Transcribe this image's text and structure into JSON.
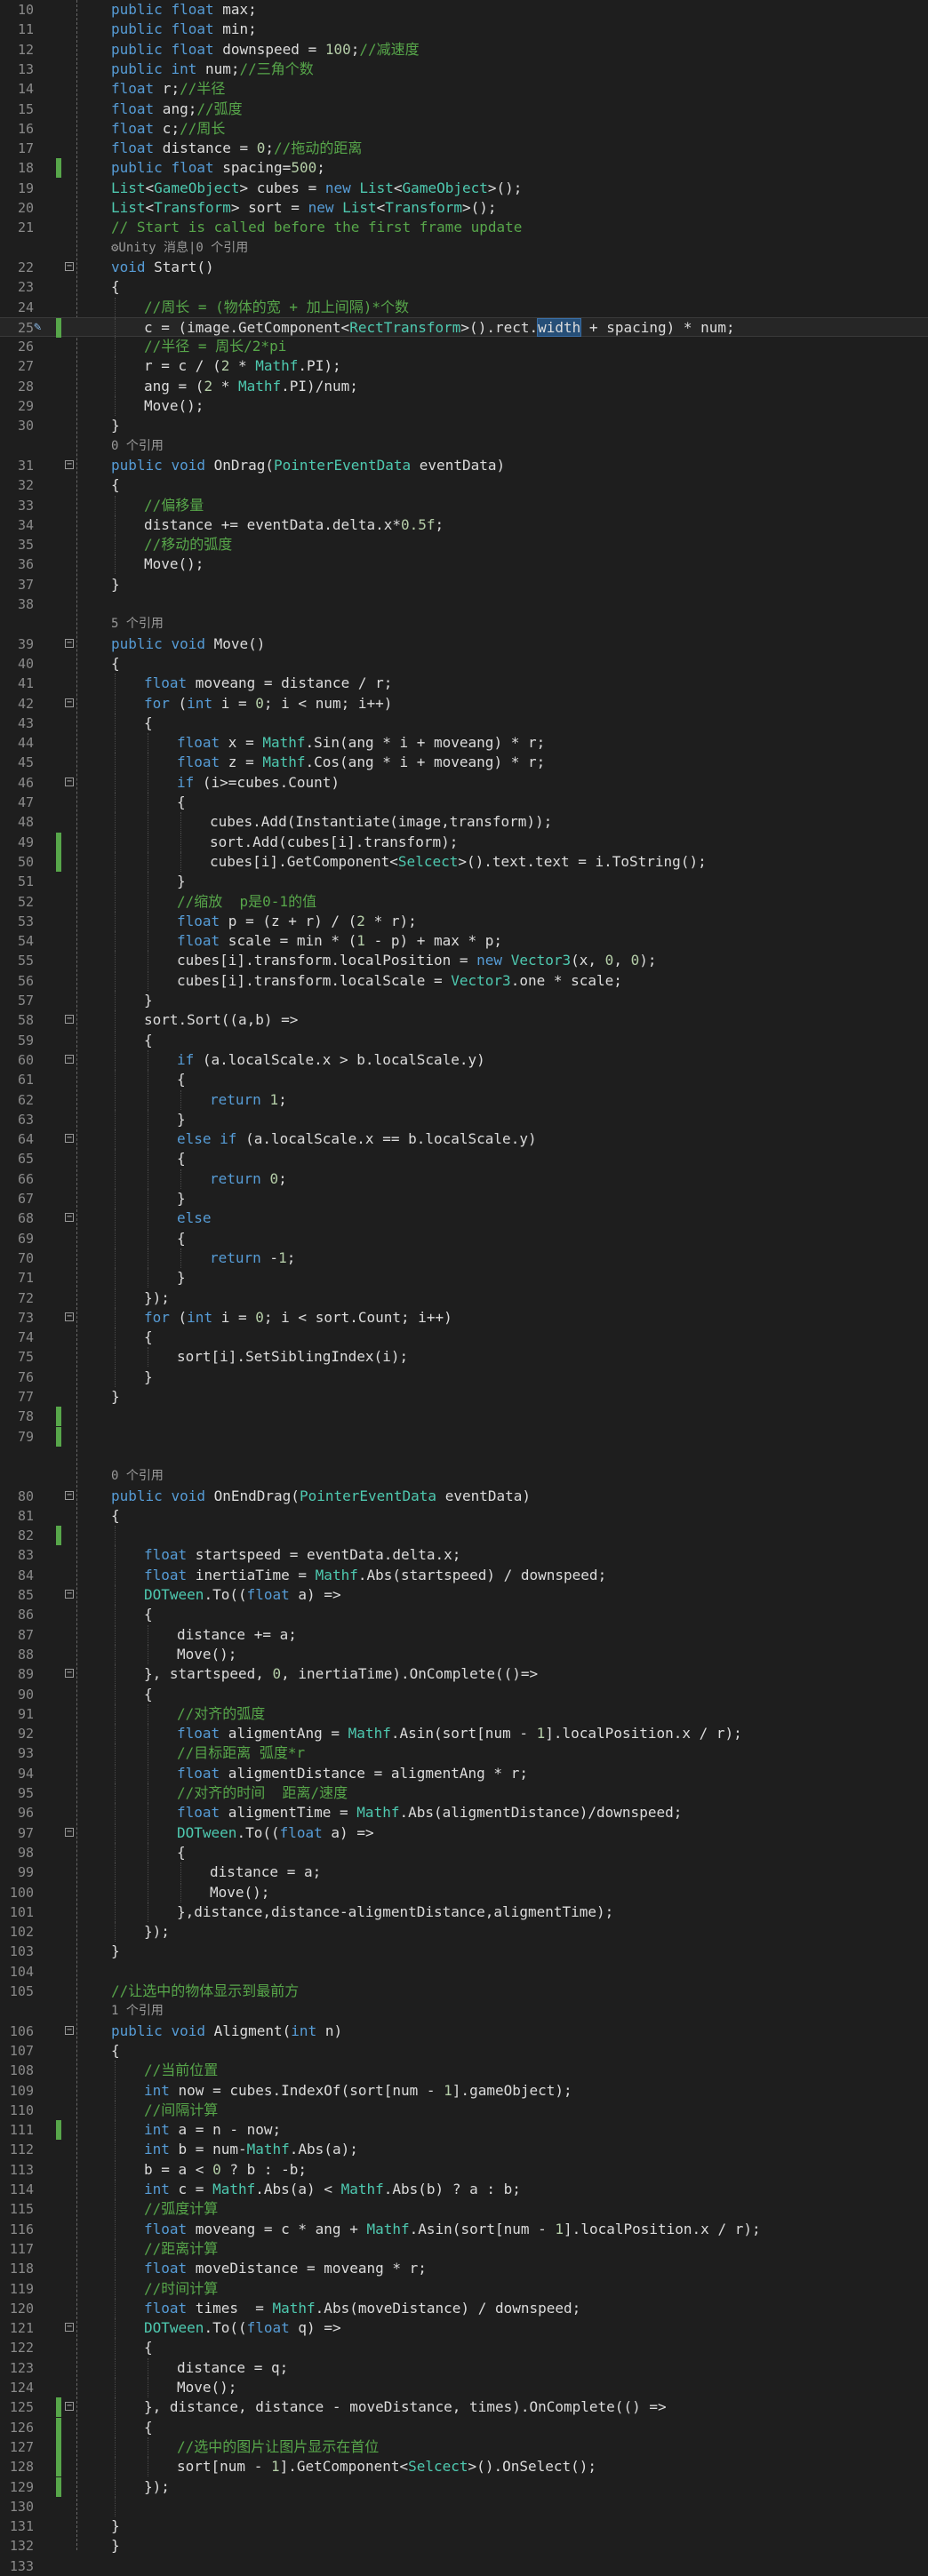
{
  "editor": {
    "lines": [
      {
        "n": "10",
        "ind": 1,
        "h": "<span class=\"kw\">public</span> <span class=\"kw\">float</span> max;",
        "chg": false
      },
      {
        "n": "11",
        "ind": 1,
        "h": "<span class=\"kw\">public</span> <span class=\"kw\">float</span> min;",
        "chg": false
      },
      {
        "n": "12",
        "ind": 1,
        "h": "<span class=\"kw\">public</span> <span class=\"kw\">float</span> downspeed = <span class=\"nm\">100</span>;<span class=\"cm\">//减速度</span>",
        "chg": false
      },
      {
        "n": "13",
        "ind": 1,
        "h": "<span class=\"kw\">public</span> <span class=\"kw\">int</span> num;<span class=\"cm\">//三角个数</span>",
        "chg": false
      },
      {
        "n": "14",
        "ind": 1,
        "h": "<span class=\"kw\">float</span> r;<span class=\"cm\">//半径</span>",
        "chg": false
      },
      {
        "n": "15",
        "ind": 1,
        "h": "<span class=\"kw\">float</span> ang;<span class=\"cm\">//弧度</span>",
        "chg": false
      },
      {
        "n": "16",
        "ind": 1,
        "h": "<span class=\"kw\">float</span> c;<span class=\"cm\">//周长</span>",
        "chg": false
      },
      {
        "n": "17",
        "ind": 1,
        "h": "<span class=\"kw\">float</span> distance = <span class=\"nm\">0</span>;<span class=\"cm\">//拖动的距离</span>",
        "chg": false
      },
      {
        "n": "18",
        "ind": 1,
        "h": "<span class=\"kw\">public</span> <span class=\"kw\">float</span> spacing=<span class=\"nm\">500</span>;",
        "chg": true
      },
      {
        "n": "19",
        "ind": 1,
        "h": "<span class=\"ty\">List</span>&lt;<span class=\"ty\">GameObject</span>&gt; cubes = <span class=\"kw\">new</span> <span class=\"ty\">List</span>&lt;<span class=\"ty\">GameObject</span>&gt;();",
        "chg": false
      },
      {
        "n": "20",
        "ind": 1,
        "h": "<span class=\"ty\">List</span>&lt;<span class=\"ty\">Transform</span>&gt; sort = <span class=\"kw\">new</span> <span class=\"ty\">List</span>&lt;<span class=\"ty\">Transform</span>&gt;();",
        "chg": false
      },
      {
        "n": "21",
        "ind": 1,
        "h": "<span class=\"cm\">// Start is called before the first frame update</span>",
        "chg": false
      },
      {
        "lens": "⚙Unity 消息|0 个引用",
        "ind": 1
      },
      {
        "n": "22",
        "ind": 1,
        "fold": true,
        "h": "<span class=\"kw\">void</span> Start()",
        "chg": false
      },
      {
        "n": "23",
        "ind": 1,
        "h": "{",
        "chg": false
      },
      {
        "n": "24",
        "ind": 2,
        "h": "<span class=\"cm\">//周长 = (物体的宽 + 加上间隔)*个数</span>",
        "chg": false
      },
      {
        "n": "25",
        "ind": 2,
        "cur": true,
        "pen": true,
        "h": "c = (image.GetComponent&lt;<span class=\"ty\">RectTransform</span>&gt;().rect.<span class=\"hl\">width</span> + spacing) * num;",
        "chg": true
      },
      {
        "n": "26",
        "ind": 2,
        "h": "<span class=\"cm\">//半径 = 周长/2*pi</span>",
        "chg": false
      },
      {
        "n": "27",
        "ind": 2,
        "h": "r = c / (<span class=\"nm\">2</span> * <span class=\"ty\">Mathf</span>.PI);",
        "chg": false
      },
      {
        "n": "28",
        "ind": 2,
        "h": "ang = (<span class=\"nm\">2</span> * <span class=\"ty\">Mathf</span>.PI)/num;",
        "chg": false
      },
      {
        "n": "29",
        "ind": 2,
        "h": "Move();",
        "chg": false
      },
      {
        "n": "30",
        "ind": 1,
        "h": "}",
        "chg": false
      },
      {
        "lens": "0 个引用",
        "ind": 1
      },
      {
        "n": "31",
        "ind": 1,
        "fold": true,
        "h": "<span class=\"kw\">public</span> <span class=\"kw\">void</span> OnDrag(<span class=\"ty\">PointerEventData</span> eventData)",
        "chg": false
      },
      {
        "n": "32",
        "ind": 1,
        "h": "{",
        "chg": false
      },
      {
        "n": "33",
        "ind": 2,
        "h": "<span class=\"cm\">//偏移量</span>",
        "chg": false
      },
      {
        "n": "34",
        "ind": 2,
        "h": "distance += eventData.delta.x*<span class=\"nm\">0.5f</span>;",
        "chg": false
      },
      {
        "n": "35",
        "ind": 2,
        "h": "<span class=\"cm\">//移动的弧度</span>",
        "chg": false
      },
      {
        "n": "36",
        "ind": 2,
        "h": "Move();",
        "chg": false
      },
      {
        "n": "37",
        "ind": 1,
        "h": "}",
        "chg": false
      },
      {
        "n": "38",
        "ind": 1,
        "h": "",
        "chg": false
      },
      {
        "lens": "5 个引用",
        "ind": 1
      },
      {
        "n": "39",
        "ind": 1,
        "fold": true,
        "h": "<span class=\"kw\">public</span> <span class=\"kw\">void</span> Move()",
        "chg": false
      },
      {
        "n": "40",
        "ind": 1,
        "h": "{",
        "chg": false
      },
      {
        "n": "41",
        "ind": 2,
        "h": "<span class=\"kw\">float</span> moveang = distance / r;",
        "chg": false
      },
      {
        "n": "42",
        "ind": 2,
        "fold": true,
        "h": "<span class=\"kw\">for</span> (<span class=\"kw\">int</span> i = <span class=\"nm\">0</span>; i &lt; num; i++)",
        "chg": false
      },
      {
        "n": "43",
        "ind": 2,
        "h": "{",
        "chg": false
      },
      {
        "n": "44",
        "ind": 3,
        "h": "<span class=\"kw\">float</span> x = <span class=\"ty\">Mathf</span>.Sin(ang * i + moveang) * r;",
        "chg": false
      },
      {
        "n": "45",
        "ind": 3,
        "h": "<span class=\"kw\">float</span> z = <span class=\"ty\">Mathf</span>.Cos(ang * i + moveang) * r;",
        "chg": false
      },
      {
        "n": "46",
        "ind": 3,
        "fold": true,
        "h": "<span class=\"kw\">if</span> (i&gt;=cubes.Count)",
        "chg": false
      },
      {
        "n": "47",
        "ind": 3,
        "h": "{",
        "chg": false
      },
      {
        "n": "48",
        "ind": 4,
        "h": "cubes.Add(Instantiate(image,transform));",
        "chg": false
      },
      {
        "n": "49",
        "ind": 4,
        "h": "sort.Add(cubes[i].transform);",
        "chg": true
      },
      {
        "n": "50",
        "ind": 4,
        "h": "cubes[i].GetComponent&lt;<span class=\"ty\">Selcect</span>&gt;().text.text = i.ToString();",
        "chg": true
      },
      {
        "n": "51",
        "ind": 3,
        "h": "}",
        "chg": false
      },
      {
        "n": "52",
        "ind": 3,
        "h": "<span class=\"cm\">//缩放  p是0-1的值</span>",
        "chg": false
      },
      {
        "n": "53",
        "ind": 3,
        "h": "<span class=\"kw\">float</span> p = (z + r) / (<span class=\"nm\">2</span> * r);",
        "chg": false
      },
      {
        "n": "54",
        "ind": 3,
        "h": "<span class=\"kw\">float</span> scale = min * (<span class=\"nm\">1</span> - p) + max * p;",
        "chg": false
      },
      {
        "n": "55",
        "ind": 3,
        "h": "cubes[i].transform.localPosition = <span class=\"kw\">new</span> <span class=\"ty\">Vector3</span>(x, <span class=\"nm\">0</span>, <span class=\"nm\">0</span>);",
        "chg": false
      },
      {
        "n": "56",
        "ind": 3,
        "h": "cubes[i].transform.localScale = <span class=\"ty\">Vector3</span>.one * scale;",
        "chg": false
      },
      {
        "n": "57",
        "ind": 2,
        "h": "}",
        "chg": false
      },
      {
        "n": "58",
        "ind": 2,
        "fold": true,
        "h": "sort.Sort((a,b) =&gt;",
        "chg": false
      },
      {
        "n": "59",
        "ind": 2,
        "h": "{",
        "chg": false
      },
      {
        "n": "60",
        "ind": 3,
        "fold": true,
        "h": "<span class=\"kw\">if</span> (a.localScale.x &gt; b.localScale.y)",
        "chg": false
      },
      {
        "n": "61",
        "ind": 3,
        "h": "{",
        "chg": false
      },
      {
        "n": "62",
        "ind": 4,
        "h": "<span class=\"kw\">return</span> <span class=\"nm\">1</span>;",
        "chg": false
      },
      {
        "n": "63",
        "ind": 3,
        "h": "}",
        "chg": false
      },
      {
        "n": "64",
        "ind": 3,
        "fold": true,
        "h": "<span class=\"kw\">else</span> <span class=\"kw\">if</span> (a.localScale.x == b.localScale.y)",
        "chg": false
      },
      {
        "n": "65",
        "ind": 3,
        "h": "{",
        "chg": false
      },
      {
        "n": "66",
        "ind": 4,
        "h": "<span class=\"kw\">return</span> <span class=\"nm\">0</span>;",
        "chg": false
      },
      {
        "n": "67",
        "ind": 3,
        "h": "}",
        "chg": false
      },
      {
        "n": "68",
        "ind": 3,
        "fold": true,
        "h": "<span class=\"kw\">else</span>",
        "chg": false
      },
      {
        "n": "69",
        "ind": 3,
        "h": "{",
        "chg": false
      },
      {
        "n": "70",
        "ind": 4,
        "h": "<span class=\"kw\">return</span> -<span class=\"nm\">1</span>;",
        "chg": false
      },
      {
        "n": "71",
        "ind": 3,
        "h": "}",
        "chg": false
      },
      {
        "n": "72",
        "ind": 2,
        "h": "});",
        "chg": false
      },
      {
        "n": "73",
        "ind": 2,
        "fold": true,
        "h": "<span class=\"kw\">for</span> (<span class=\"kw\">int</span> i = <span class=\"nm\">0</span>; i &lt; sort.Count; i++)",
        "chg": false
      },
      {
        "n": "74",
        "ind": 2,
        "h": "{",
        "chg": false
      },
      {
        "n": "75",
        "ind": 3,
        "h": "sort[i].SetSiblingIndex(i);",
        "chg": false
      },
      {
        "n": "76",
        "ind": 2,
        "h": "}",
        "chg": false
      },
      {
        "n": "77",
        "ind": 1,
        "h": "}",
        "chg": false
      },
      {
        "n": "78",
        "ind": 1,
        "h": "",
        "chg": true
      },
      {
        "n": "79",
        "ind": 1,
        "h": "",
        "chg": true
      },
      {
        "blank": true
      },
      {
        "lens": "0 个引用",
        "ind": 1
      },
      {
        "n": "80",
        "ind": 1,
        "fold": true,
        "h": "<span class=\"kw\">public</span> <span class=\"kw\">void</span> OnEndDrag(<span class=\"ty\">PointerEventData</span> eventData)",
        "chg": false
      },
      {
        "n": "81",
        "ind": 1,
        "h": "{",
        "chg": false
      },
      {
        "n": "82",
        "ind": 2,
        "h": "",
        "chg": true
      },
      {
        "n": "83",
        "ind": 2,
        "h": "<span class=\"kw\">float</span> startspeed = eventData.delta.x;",
        "chg": false
      },
      {
        "n": "84",
        "ind": 2,
        "h": "<span class=\"kw\">float</span> inertiaTime = <span class=\"ty\">Mathf</span>.Abs(startspeed) / downspeed;",
        "chg": false
      },
      {
        "n": "85",
        "ind": 2,
        "fold": true,
        "h": "<span class=\"ty\">DOTween</span>.To((<span class=\"kw\">float</span> a) =&gt;",
        "chg": false
      },
      {
        "n": "86",
        "ind": 2,
        "h": "{",
        "chg": false
      },
      {
        "n": "87",
        "ind": 3,
        "h": "distance += a;",
        "chg": false
      },
      {
        "n": "88",
        "ind": 3,
        "h": "Move();",
        "chg": false
      },
      {
        "n": "89",
        "ind": 2,
        "fold": true,
        "h": "}, startspeed, <span class=\"nm\">0</span>, inertiaTime).OnComplete(()=&gt;",
        "chg": false
      },
      {
        "n": "90",
        "ind": 2,
        "h": "{",
        "chg": false
      },
      {
        "n": "91",
        "ind": 3,
        "h": "<span class=\"cm\">//对齐的弧度</span>",
        "chg": false
      },
      {
        "n": "92",
        "ind": 3,
        "h": "<span class=\"kw\">float</span> aligmentAng = <span class=\"ty\">Mathf</span>.Asin(sort[num - <span class=\"nm\">1</span>].localPosition.x / r);",
        "chg": false
      },
      {
        "n": "93",
        "ind": 3,
        "h": "<span class=\"cm\">//目标距离 弧度*r</span>",
        "chg": false
      },
      {
        "n": "94",
        "ind": 3,
        "h": "<span class=\"kw\">float</span> aligmentDistance = aligmentAng * r;",
        "chg": false
      },
      {
        "n": "95",
        "ind": 3,
        "h": "<span class=\"cm\">//对齐的时间  距离/速度</span>",
        "chg": false
      },
      {
        "n": "96",
        "ind": 3,
        "h": "<span class=\"kw\">float</span> aligmentTime = <span class=\"ty\">Mathf</span>.Abs(aligmentDistance)/downspeed;",
        "chg": false
      },
      {
        "n": "97",
        "ind": 3,
        "fold": true,
        "h": "<span class=\"ty\">DOTween</span>.To((<span class=\"kw\">float</span> a) =&gt;",
        "chg": false
      },
      {
        "n": "98",
        "ind": 3,
        "h": "{",
        "chg": false
      },
      {
        "n": "99",
        "ind": 4,
        "h": "distance = a;",
        "chg": false
      },
      {
        "n": "100",
        "ind": 4,
        "h": "Move();",
        "chg": false
      },
      {
        "n": "101",
        "ind": 3,
        "h": "},distance,distance-aligmentDistance,aligmentTime);",
        "chg": false
      },
      {
        "n": "102",
        "ind": 2,
        "h": "});",
        "chg": false
      },
      {
        "n": "103",
        "ind": 1,
        "h": "}",
        "chg": false
      },
      {
        "n": "104",
        "ind": 1,
        "h": "",
        "chg": false
      },
      {
        "n": "105",
        "ind": 1,
        "h": "<span class=\"cm\">//让选中的物体显示到最前方</span>",
        "chg": false
      },
      {
        "lens": "1 个引用",
        "ind": 1
      },
      {
        "n": "106",
        "ind": 1,
        "fold": true,
        "h": "<span class=\"kw\">public</span> <span class=\"kw\">void</span> Aligment(<span class=\"kw\">int</span> n)",
        "chg": false
      },
      {
        "n": "107",
        "ind": 1,
        "h": "{",
        "chg": false
      },
      {
        "n": "108",
        "ind": 2,
        "h": "<span class=\"cm\">//当前位置</span>",
        "chg": false
      },
      {
        "n": "109",
        "ind": 2,
        "h": "<span class=\"kw\">int</span> now = cubes.IndexOf(sort[num - <span class=\"nm\">1</span>].gameObject);",
        "chg": false
      },
      {
        "n": "110",
        "ind": 2,
        "h": "<span class=\"cm\">//间隔计算</span>",
        "chg": false
      },
      {
        "n": "111",
        "ind": 2,
        "h": "<span class=\"kw\">int</span> a = n - now;",
        "chg": true
      },
      {
        "n": "112",
        "ind": 2,
        "h": "<span class=\"kw\">int</span> b = num-<span class=\"ty\">Mathf</span>.Abs(a);",
        "chg": false
      },
      {
        "n": "113",
        "ind": 2,
        "h": "b = a &lt; <span class=\"nm\">0</span> ? b : -b;",
        "chg": false
      },
      {
        "n": "114",
        "ind": 2,
        "h": "<span class=\"kw\">int</span> c = <span class=\"ty\">Mathf</span>.Abs(a) &lt; <span class=\"ty\">Mathf</span>.Abs(b) ? a : b;",
        "chg": false
      },
      {
        "n": "115",
        "ind": 2,
        "h": "<span class=\"cm\">//弧度计算</span>",
        "chg": false
      },
      {
        "n": "116",
        "ind": 2,
        "h": "<span class=\"kw\">float</span> moveang = c * ang + <span class=\"ty\">Mathf</span>.Asin(sort[num - <span class=\"nm\">1</span>].localPosition.x / r);",
        "chg": false
      },
      {
        "n": "117",
        "ind": 2,
        "h": "<span class=\"cm\">//距离计算</span>",
        "chg": false
      },
      {
        "n": "118",
        "ind": 2,
        "h": "<span class=\"kw\">float</span> moveDistance = moveang * r;",
        "chg": false
      },
      {
        "n": "119",
        "ind": 2,
        "h": "<span class=\"cm\">//时间计算</span>",
        "chg": false
      },
      {
        "n": "120",
        "ind": 2,
        "h": "<span class=\"kw\">float</span> times  = <span class=\"ty\">Mathf</span>.Abs(moveDistance) / downspeed;",
        "chg": false
      },
      {
        "n": "121",
        "ind": 2,
        "fold": true,
        "h": "<span class=\"ty\">DOTween</span>.To((<span class=\"kw\">float</span> q) =&gt;",
        "chg": false
      },
      {
        "n": "122",
        "ind": 2,
        "h": "{",
        "chg": false
      },
      {
        "n": "123",
        "ind": 3,
        "h": "distance = q;",
        "chg": false
      },
      {
        "n": "124",
        "ind": 3,
        "h": "Move();",
        "chg": false
      },
      {
        "n": "125",
        "ind": 2,
        "fold": true,
        "h": "}, distance, distance - moveDistance, times).OnComplete(() =&gt;",
        "chg": true
      },
      {
        "n": "126",
        "ind": 2,
        "h": "{",
        "chg": true
      },
      {
        "n": "127",
        "ind": 3,
        "h": "<span class=\"cm\">//选中的图片让图片显示在首位</span>",
        "chg": true
      },
      {
        "n": "128",
        "ind": 3,
        "h": "sort[num - <span class=\"nm\">1</span>].GetComponent&lt;<span class=\"ty\">Selcect</span>&gt;().OnSelect();",
        "chg": true
      },
      {
        "n": "129",
        "ind": 2,
        "h": "});",
        "chg": true
      },
      {
        "n": "130",
        "ind": 2,
        "h": "",
        "chg": false
      },
      {
        "n": "131",
        "ind": 1,
        "h": "}",
        "chg": false
      },
      {
        "n": "132",
        "ind": 0,
        "h": "}",
        "chg": false
      },
      {
        "n": "133",
        "ind": 0,
        "h": "",
        "chg": false
      }
    ]
  }
}
